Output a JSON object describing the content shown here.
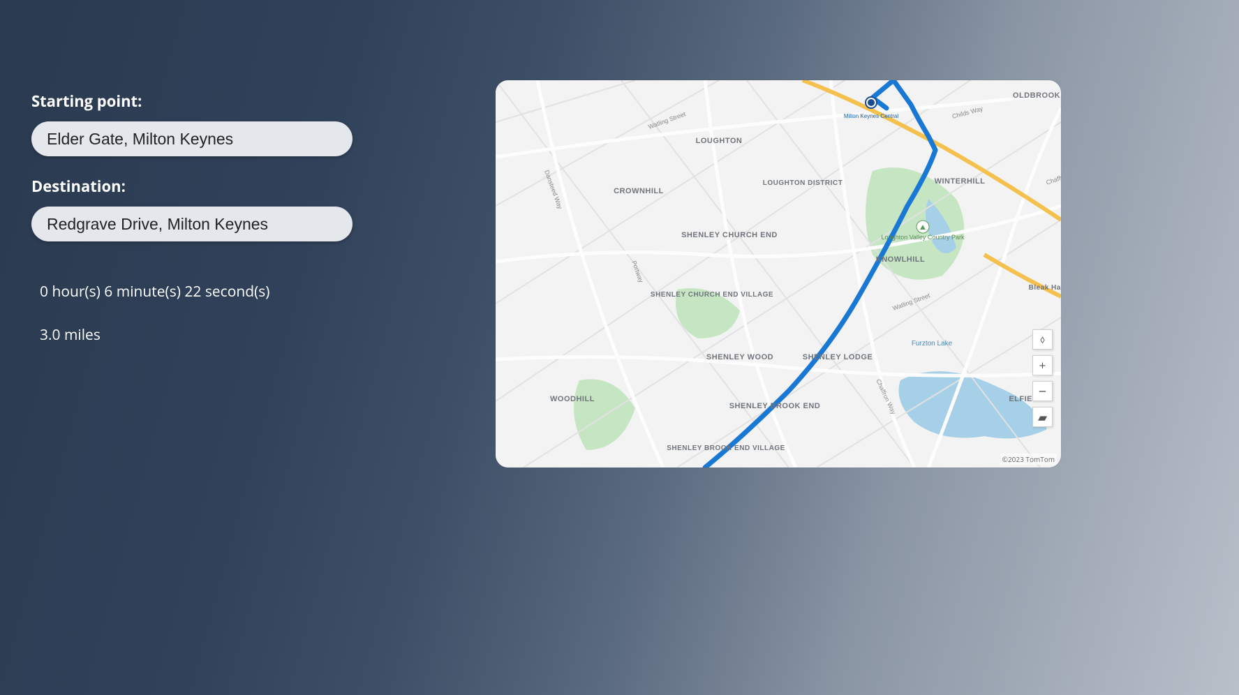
{
  "form": {
    "start_label": "Starting point:",
    "start_value": "Elder Gate, Milton Keynes",
    "dest_label": "Destination:",
    "dest_value": "Redgrave Drive, Milton Keynes"
  },
  "result": {
    "duration": "0 hour(s) 6 minute(s) 22 second(s)",
    "distance": "3.0 miles"
  },
  "map": {
    "attribution": "©2023 TomTom",
    "places": {
      "loughton": "LOUGHTON",
      "crownhill": "CROWNHILL",
      "loughton_district": "LOUGHTON DISTRICT",
      "winterhill": "WINTERHILL",
      "oldbrook": "OLDBROOK",
      "shenley_church_end": "SHENLEY CHURCH END",
      "knowlhill": "KNOWLHILL",
      "shenley_church_end_village": "SHENLEY CHURCH END VILLAGE",
      "bleak_hall": "Bleak Hall",
      "shenley_wood": "SHENLEY WOOD",
      "shenley_lodge": "SHENLEY LODGE",
      "woodhill": "WOODHILL",
      "shenley_brook_end": "SHENLEY BROOK END",
      "elfield": "ELFIELD",
      "shenley_brook_end_village": "SHENLEY BROOK END VILLAGE",
      "furzton_lake": "Furzton Lake",
      "loughton_valley_park": "Loughton Valley Country Park",
      "mk_central": "Milton Keynes Central"
    },
    "roads": {
      "watling_street": "Watling Street",
      "dansteed_way": "Dansteed Way",
      "portway": "Portway",
      "childs_way": "Childs Way",
      "chaffron_way": "Chaffron Way"
    },
    "controls": {
      "compass": "◊",
      "zoom_in": "+",
      "zoom_out": "−",
      "tilt": "▰"
    }
  }
}
